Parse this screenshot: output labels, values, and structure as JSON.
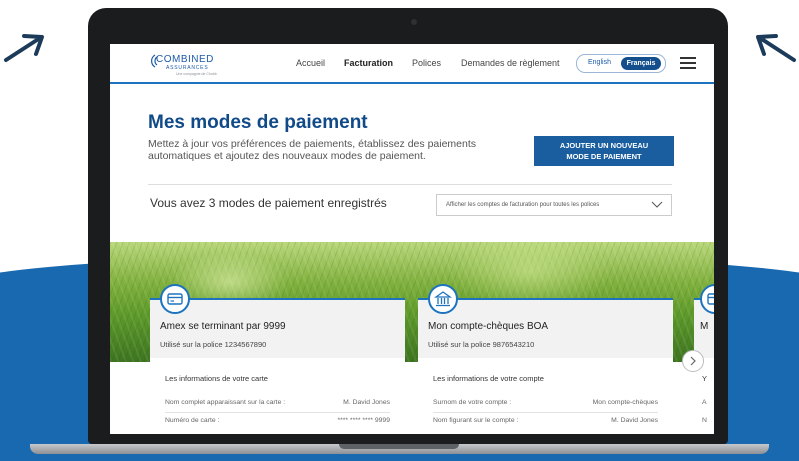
{
  "icons": {
    "left_arrow": "arrow-right-icon",
    "right_arrow": "arrow-left-icon",
    "menu": "hamburger-menu-icon",
    "card": "credit-card-icon",
    "bank": "bank-icon",
    "chevron": "chevron-down-icon",
    "next": "chevron-right-icon"
  },
  "colors": {
    "brand_blue": "#1e73be",
    "dark_blue": "#114a88",
    "background_blue": "#1869b0"
  },
  "header": {
    "logo_text": "COMBINED",
    "logo_sub": "ASSURANCES",
    "logo_tagline": "Une compagnie de Chubb",
    "nav": [
      {
        "label": "Accueil"
      },
      {
        "label": "Facturation"
      },
      {
        "label": "Polices"
      },
      {
        "label": "Demandes de règlement"
      }
    ],
    "lang_en": "English",
    "lang_fr": "Français"
  },
  "page": {
    "title": "Mes modes de paiement",
    "subtitle": "Mettez à jour vos préférences de paiements, établissez des paiements automatiques et ajoutez des nouveaux modes de paiement.",
    "cta_line1": "AJOUTER UN NOUVEAU",
    "cta_line2": "MODE DE PAIEMENT",
    "count_text": "Vous avez 3 modes de paiement enregistrés",
    "filter_value": "Afficher les comptes de facturation pour toutes les polices"
  },
  "cards": [
    {
      "name": "Amex se terminant par 9999",
      "used_on": "Utilisé sur la police 1234567890",
      "section": "Les informations de votre carte",
      "rows": [
        {
          "label": "Nom complet apparaissant sur la carte :",
          "value": "M. David Jones"
        },
        {
          "label": "Numéro de carte :",
          "value": "**** **** **** 9999"
        }
      ]
    },
    {
      "name": "Mon compte-chèques BOA",
      "used_on": "Utilisé sur la police 9876543210",
      "section": "Les informations de votre compte",
      "rows": [
        {
          "label": "Surnom de votre compte :",
          "value": "Mon compte-chèques"
        },
        {
          "label": "Nom figurant sur le compte :",
          "value": "M. David Jones"
        }
      ]
    },
    {
      "name_partial": "M",
      "section_partial": "Y",
      "row_partials": [
        "A",
        "N"
      ]
    }
  ]
}
